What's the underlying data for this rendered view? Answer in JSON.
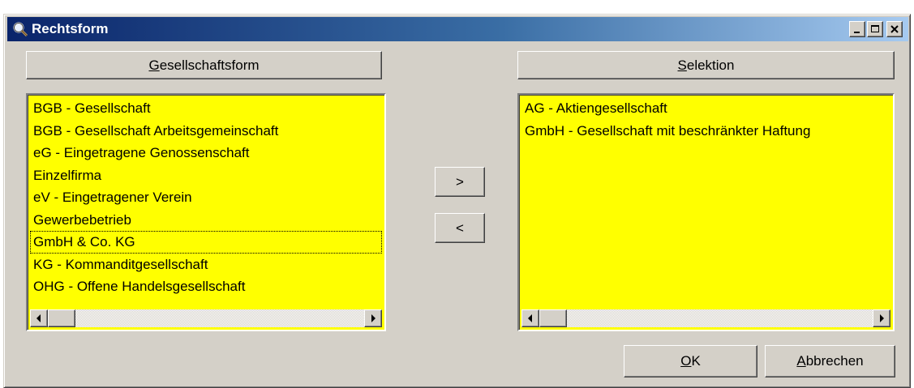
{
  "window": {
    "title": "Rechtsform"
  },
  "available": {
    "header_label": "Gesellschaftsform",
    "header_mnemonic": "G",
    "header_rest": "esellschaftsform",
    "items": [
      {
        "label": "BGB - Gesellschaft"
      },
      {
        "label": "BGB - Gesellschaft Arbeitsgemeinschaft"
      },
      {
        "label": "eG - Eingetragene Genossenschaft"
      },
      {
        "label": "Einzelfirma"
      },
      {
        "label": "eV - Eingetragener Verein"
      },
      {
        "label": "Gewerbebetrieb"
      },
      {
        "label": "GmbH & Co. KG",
        "focused": true
      },
      {
        "label": "KG - Kommanditgesellschaft"
      },
      {
        "label": "OHG - Offene Handelsgesellschaft"
      }
    ]
  },
  "selected": {
    "header_label": "Selektion",
    "header_mnemonic": "S",
    "header_rest": "elektion",
    "items": [
      {
        "label": "AG - Aktiengesellschaft"
      },
      {
        "label": "GmbH - Gesellschaft mit beschränkter Haftung"
      }
    ]
  },
  "buttons": {
    "add_label": ">",
    "remove_label": "<",
    "ok_mnemonic": "O",
    "ok_rest": "K",
    "cancel_mnemonic": "A",
    "cancel_rest": "bbrechen"
  },
  "colors": {
    "list_background": "#ffff00",
    "face": "#d4d0c8",
    "title_start": "#0a246a",
    "title_end": "#a6caf0"
  }
}
